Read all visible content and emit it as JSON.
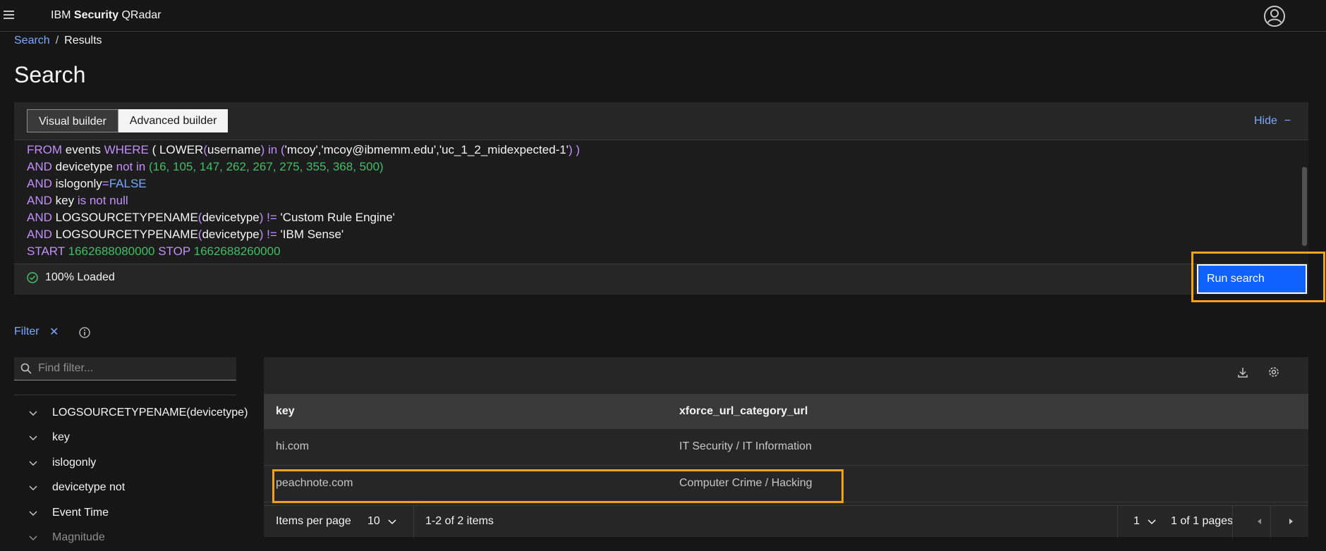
{
  "header": {
    "brand_prefix": "IBM ",
    "brand_bold": "Security",
    "brand_suffix": " QRadar",
    "menu_icon": "hamburger-menu-icon",
    "user_icon": "user-avatar-icon"
  },
  "breadcrumb": {
    "link": "Search",
    "separator": "/",
    "current": "Results"
  },
  "page": {
    "title": "Search"
  },
  "builder": {
    "tabs": [
      {
        "label": "Visual builder",
        "active": true
      },
      {
        "label": "Advanced builder",
        "active": false
      }
    ],
    "hide_label": "Hide",
    "hide_icon": "minus-icon",
    "query_lines": [
      [
        [
          "kw",
          "FROM"
        ],
        [
          "fn",
          " events "
        ],
        [
          "kw",
          "WHERE"
        ],
        [
          "fn",
          " ( LOWER"
        ],
        [
          "kw",
          "("
        ],
        [
          "fn",
          "username"
        ],
        [
          "kw",
          ")"
        ],
        [
          "fn",
          " "
        ],
        [
          "kw",
          "in"
        ],
        [
          "fn",
          " "
        ],
        [
          "kw",
          "("
        ],
        [
          "str",
          "'mcoy','mcoy@ibmemm.edu','uc_1_2_midexpected-1'"
        ],
        [
          "kw",
          ") )"
        ]
      ],
      [
        [
          "kw",
          "AND"
        ],
        [
          "fn",
          " devicetype "
        ],
        [
          "kw",
          "not in"
        ],
        [
          "fn",
          " "
        ],
        [
          "num",
          "(16, 105, 147, 262, 267, 275, 355, 368, 500)"
        ]
      ],
      [
        [
          "kw",
          "AND"
        ],
        [
          "fn",
          " islogonly"
        ],
        [
          "kw",
          "="
        ],
        [
          "bool",
          "FALSE"
        ]
      ],
      [
        [
          "kw",
          "AND"
        ],
        [
          "fn",
          " key "
        ],
        [
          "kw",
          "is not null"
        ]
      ],
      [
        [
          "kw",
          "AND"
        ],
        [
          "fn",
          " LOGSOURCETYPENAME"
        ],
        [
          "kw",
          "("
        ],
        [
          "fn",
          "devicetype"
        ],
        [
          "kw",
          ")"
        ],
        [
          "fn",
          " "
        ],
        [
          "kw",
          "!="
        ],
        [
          "str",
          " 'Custom Rule Engine'"
        ]
      ],
      [
        [
          "kw",
          "AND"
        ],
        [
          "fn",
          " LOGSOURCETYPENAME"
        ],
        [
          "kw",
          "("
        ],
        [
          "fn",
          "devicetype"
        ],
        [
          "kw",
          ")"
        ],
        [
          "fn",
          " "
        ],
        [
          "kw",
          "!="
        ],
        [
          "str",
          " 'IBM Sense'"
        ]
      ],
      [
        [
          "kw",
          "START"
        ],
        [
          "num",
          " 1662688080000 "
        ],
        [
          "kw",
          "STOP"
        ],
        [
          "num",
          " 1662688260000"
        ]
      ]
    ],
    "status": "100% Loaded",
    "status_icon": "checkmark-outline-icon",
    "run_label": "Run search"
  },
  "filter": {
    "label": "Filter",
    "clear_icon": "close-icon",
    "info_icon": "information-icon",
    "search_placeholder": "Find filter...",
    "search_value": "",
    "facets": [
      {
        "label": "LOGSOURCETYPENAME(devicetype)",
        "dim": false
      },
      {
        "label": "key",
        "dim": false
      },
      {
        "label": "islogonly",
        "dim": false
      },
      {
        "label": "devicetype not",
        "dim": false
      },
      {
        "label": "Event Time",
        "dim": false
      },
      {
        "label": "Magnitude",
        "dim": true
      }
    ]
  },
  "results": {
    "toolbar_icons": [
      "download-icon",
      "settings-icon"
    ],
    "columns": [
      "key",
      "xforce_url_category_url"
    ],
    "rows": [
      [
        "hi.com",
        "IT Security / IT Information"
      ],
      [
        "peachnote.com",
        "Computer Crime / Hacking"
      ]
    ],
    "pagination": {
      "items_per_page_label": "Items per page",
      "items_per_page_value": "10",
      "range_text": "1-2 of 2 items",
      "page_value": "1",
      "pages_text": "1 of 1 pages",
      "prev_icon": "caret-left-icon",
      "next_icon": "caret-right-icon"
    }
  },
  "colors": {
    "background": "#161616",
    "panel": "#262626",
    "link": "#78a9ff",
    "primary_button": "#0f62fe",
    "highlight": "#f1a11b",
    "keyword": "#c28ffc",
    "number": "#42be65"
  }
}
